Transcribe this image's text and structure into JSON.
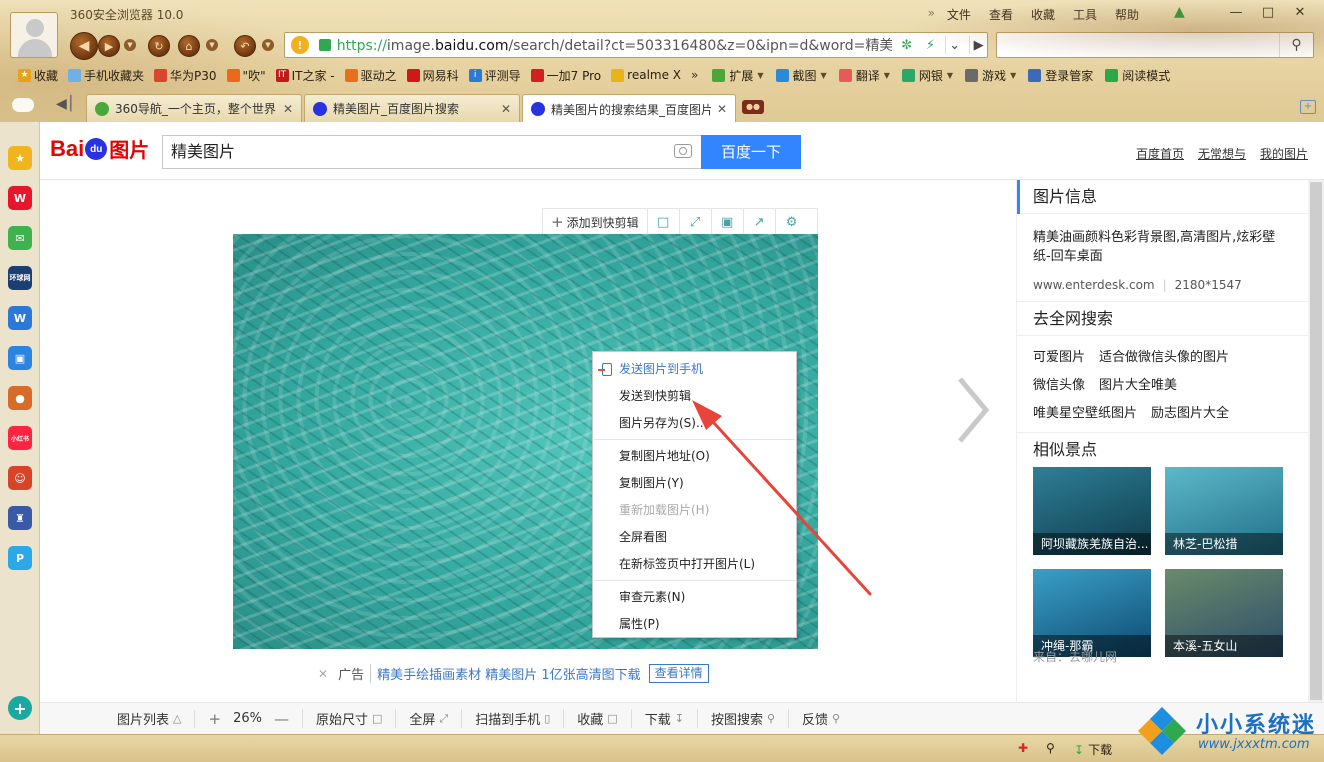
{
  "browser": {
    "title": "360安全浏览器 10.0",
    "menu": [
      "文件",
      "查看",
      "收藏",
      "工具",
      "帮助"
    ],
    "address": {
      "scheme": "https://",
      "host_prefix": "image.",
      "host": "baidu.com",
      "path": "/search/detail?ct=503316480&z=0&ipn=d&word=精美图片"
    },
    "search_placeholder": "",
    "favorites": [
      "收藏",
      "手机收藏夹",
      "华为P30",
      "\"吹\"",
      "IT之家 -",
      "驱动之",
      "网易科",
      "评测导",
      "一加7 Pro",
      "realme X"
    ],
    "favorites_more": "»",
    "tools": [
      "扩展",
      "截图",
      "翻译",
      "网银",
      "游戏",
      "登录管家",
      "阅读模式"
    ],
    "tabs": [
      {
        "label": "360导航_一个主页，整个世界",
        "active": false
      },
      {
        "label": "精美图片_百度图片搜索",
        "active": false
      },
      {
        "label": "精美图片的搜索结果_百度图片",
        "active": true
      }
    ]
  },
  "sidebar_icons": [
    "favorites-star-icon",
    "weibo-icon",
    "mail-icon",
    "news-icon",
    "word-icon",
    "message-icon",
    "game-icon",
    "xiaohongshu-icon",
    "hero-icon",
    "castle-icon",
    "p-app-icon",
    "add-icon"
  ],
  "sidebar_labels": {
    "news": "环球网",
    "xhs": "小红书"
  },
  "page": {
    "logo_a": "Bai",
    "logo_paw": "du",
    "logo_b": "图片",
    "query": "精美图片",
    "search_button": "百度一下",
    "header_links": [
      "百度首页",
      "无常想与",
      "我的图片"
    ],
    "image_tools": {
      "add_label": "添加到快剪辑"
    },
    "ad": {
      "tag": "广告",
      "link": "精美手绘插画素材 精美图片 1亿张高清图下载",
      "details": "查看详情"
    },
    "info": {
      "title": "图片信息",
      "desc": "精美油画颜料色彩背景图,高清图片,炫彩壁纸-回车桌面",
      "site": "www.enterdesk.com",
      "size": "2180*1547"
    },
    "web_search": {
      "title": "去全网搜索",
      "rows": [
        [
          "可爱图片",
          "适合做微信头像的图片"
        ],
        [
          "微信头像",
          "图片大全唯美"
        ],
        [
          "唯美星空壁纸图片",
          "励志图片大全"
        ]
      ]
    },
    "similar": {
      "title": "相似景点",
      "items": [
        {
          "label": "阿坝藏族羌族自治...",
          "color_a": "#2f7f97",
          "color_b": "#0e3a4a"
        },
        {
          "label": "林芝-巴松措",
          "color_a": "#5eb8c9",
          "color_b": "#1f6f88"
        },
        {
          "label": "冲绳-那霸",
          "color_a": "#3b9fc8",
          "color_b": "#0d4a70"
        },
        {
          "label": "本溪-五女山",
          "color_a": "#6a8b6a",
          "color_b": "#2c4d6a"
        }
      ]
    },
    "source": "来自：去哪儿网",
    "bottom_toolbar": {
      "list": "图片列表",
      "zoom_plus": "+",
      "zoom": "26%",
      "zoom_minus": "—",
      "original": "原始尺寸",
      "fullscreen": "全屏",
      "scan": "扫描到手机",
      "collect": "收藏",
      "download": "下载",
      "search_by_image": "按图搜索",
      "feedback": "反馈"
    }
  },
  "context_menu": [
    {
      "label": "发送图片到手机",
      "state": "highlight"
    },
    {
      "label": "发送到快剪辑",
      "state": "normal"
    },
    {
      "label": "图片另存为(S)...",
      "state": "normal"
    },
    {
      "label": "复制图片地址(O)",
      "state": "normal"
    },
    {
      "label": "复制图片(Y)",
      "state": "normal"
    },
    {
      "label": "重新加载图片(H)",
      "state": "disabled"
    },
    {
      "label": "全屏看图",
      "state": "normal"
    },
    {
      "label": "在新标签页中打开图片(L)",
      "state": "normal"
    },
    {
      "label": "审查元素(N)",
      "state": "normal"
    },
    {
      "label": "属性(P)",
      "state": "normal"
    }
  ],
  "status": {
    "download": "下载"
  },
  "watermark": {
    "title": "小小系统迷",
    "url": "www.jxxxtm.com"
  },
  "colors": {
    "accent": "#3385ff",
    "logo_red": "#e10601",
    "logo_blue": "#2932e1",
    "arrow_red": "#e8443a",
    "link_blue": "#3b78c4"
  }
}
